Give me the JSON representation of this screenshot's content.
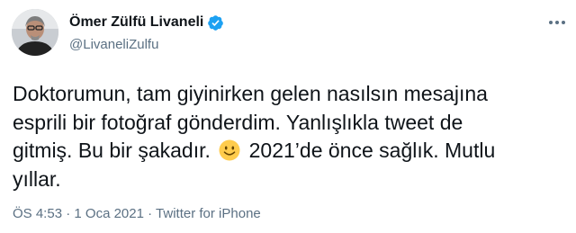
{
  "user": {
    "display_name": "Ömer Zülfü Livaneli",
    "handle": "@LivaneliZulfu",
    "verified_icon": "verified-badge-icon",
    "avatar_icon": "avatar-photo",
    "accent_color": "#1da1f2"
  },
  "tweet": {
    "lines": [
      "Doktorumun, tam giyinirken gelen nasılsın mesajına",
      "esprili bir fotoğraf gönderdim. Yanlışlıkla tweet de",
      "gitmiş. Bu bir şakadır.",
      "2021’de önce sağlık. Mutlu",
      "yıllar."
    ],
    "emoji_icon": "slightly-smiling-face-icon"
  },
  "meta": {
    "time": "ÖS 4:53",
    "separator": "·",
    "date": "1 Oca 2021",
    "source": "Twitter for iPhone"
  },
  "more_icon": "more-options-icon"
}
